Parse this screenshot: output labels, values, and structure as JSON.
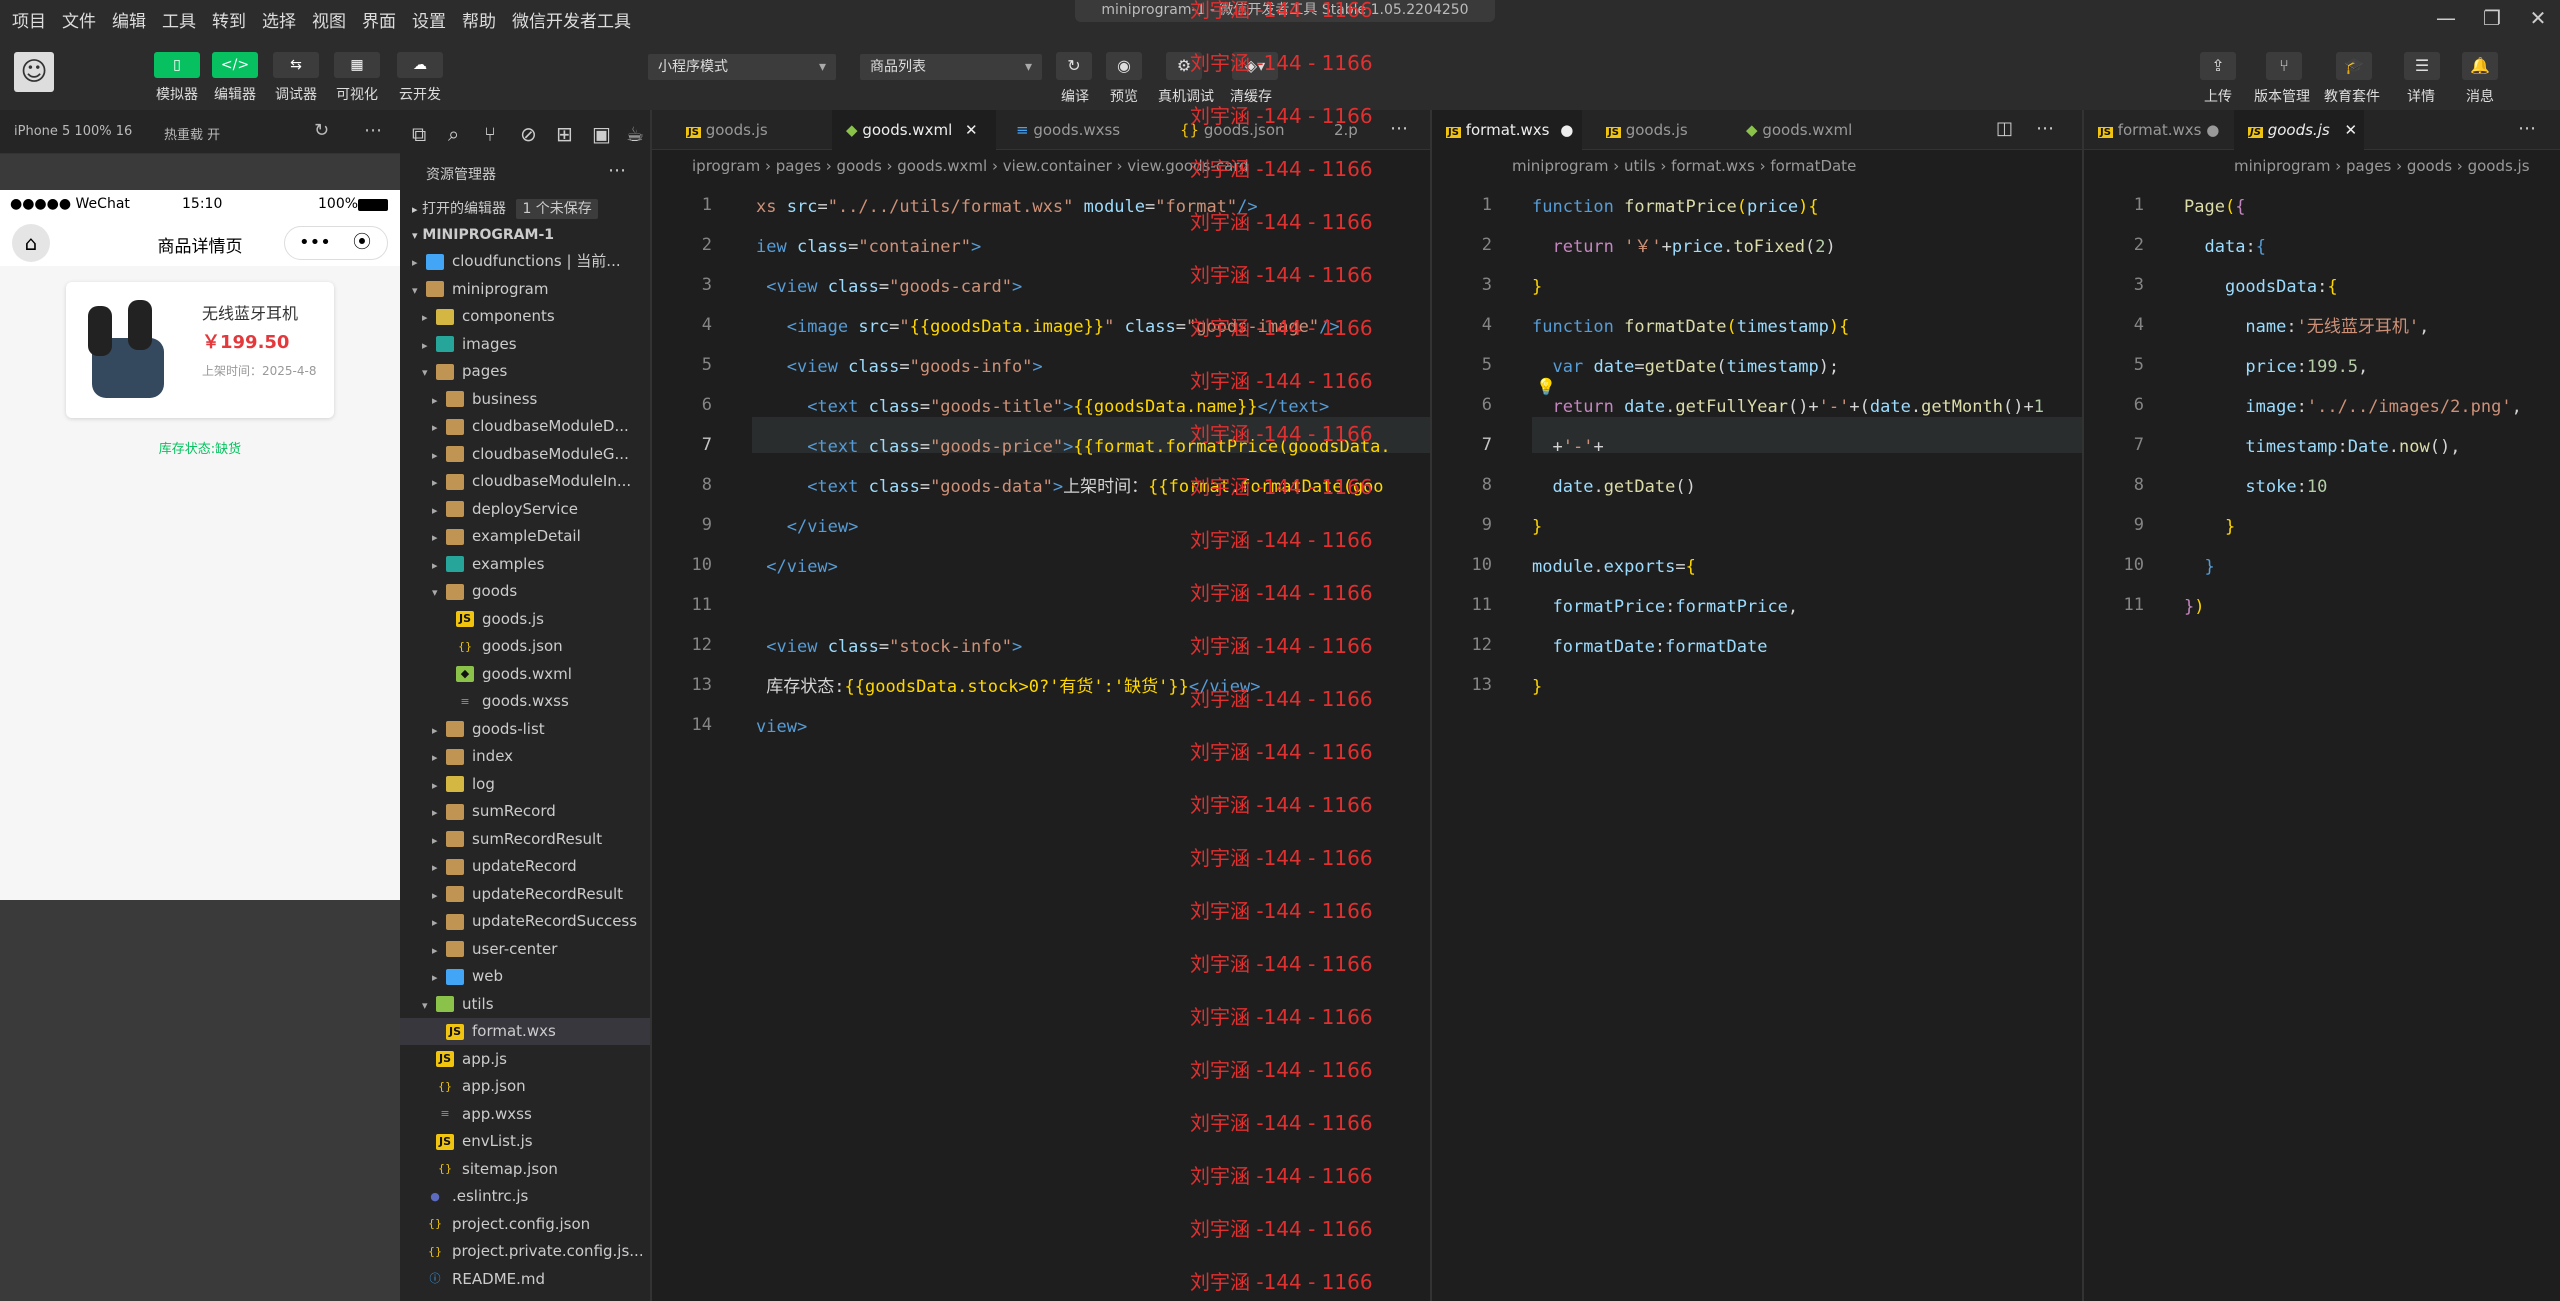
{
  "menu": [
    "项目",
    "文件",
    "编辑",
    "工具",
    "转到",
    "选择",
    "视图",
    "界面",
    "设置",
    "帮助",
    "微信开发者工具"
  ],
  "window_title": "miniprogram-1 - 微信开发者工具 Stable 1.05.2204250",
  "toolbar": {
    "simulator": "模拟器",
    "editor": "编辑器",
    "debugger": "调试器",
    "visual": "可视化",
    "cloud": "云开发",
    "mode_select": "小程序模式",
    "page_select": "商品列表",
    "compile": "编译",
    "preview": "预览",
    "remote_debug": "真机调试",
    "clear_cache": "清缓存",
    "upload": "上传",
    "version": "版本管理",
    "edu": "教育套件",
    "details": "详情",
    "messages": "消息"
  },
  "simbar": {
    "device": "iPhone 5 100% 16",
    "hot_reload": "热重载 开"
  },
  "phone": {
    "carrier": "●●●●● WeChat",
    "time": "15:10",
    "battery": "100%",
    "nav_title": "商品详情页",
    "goods_title": "无线蓝牙耳机",
    "goods_price": "￥199.50",
    "goods_date": "上架时间：2025-4-8",
    "stock": "库存状态:缺货"
  },
  "explorer": {
    "title": "资源管理器",
    "open_editors": "打开的编辑器",
    "unsaved": "1 个未保存",
    "project": "MINIPROGRAM-1",
    "items": [
      {
        "label": "cloudfunctions | 当前...",
        "depth": 1,
        "type": "folder-blue",
        "arrow": "▸"
      },
      {
        "label": "miniprogram",
        "depth": 1,
        "type": "folder",
        "arrow": "▾"
      },
      {
        "label": "components",
        "depth": 2,
        "type": "folder-yellow",
        "arrow": "▸"
      },
      {
        "label": "images",
        "depth": 2,
        "type": "folder-teal",
        "arrow": "▸"
      },
      {
        "label": "pages",
        "depth": 2,
        "type": "folder",
        "arrow": "▾"
      },
      {
        "label": "business",
        "depth": 3,
        "type": "folder",
        "arrow": "▸"
      },
      {
        "label": "cloudbaseModuleD...",
        "depth": 3,
        "type": "folder",
        "arrow": "▸"
      },
      {
        "label": "cloudbaseModuleG...",
        "depth": 3,
        "type": "folder",
        "arrow": "▸"
      },
      {
        "label": "cloudbaseModuleIn...",
        "depth": 3,
        "type": "folder",
        "arrow": "▸"
      },
      {
        "label": "deployService",
        "depth": 3,
        "type": "folder",
        "arrow": "▸"
      },
      {
        "label": "exampleDetail",
        "depth": 3,
        "type": "folder",
        "arrow": "▸"
      },
      {
        "label": "examples",
        "depth": 3,
        "type": "folder-teal",
        "arrow": "▸"
      },
      {
        "label": "goods",
        "depth": 3,
        "type": "folder",
        "arrow": "▾"
      },
      {
        "label": "goods.js",
        "depth": 4,
        "type": "js",
        "arrow": ""
      },
      {
        "label": "goods.json",
        "depth": 4,
        "type": "json",
        "arrow": ""
      },
      {
        "label": "goods.wxml",
        "depth": 4,
        "type": "wxml",
        "arrow": ""
      },
      {
        "label": "goods.wxss",
        "depth": 4,
        "type": "wxss",
        "arrow": ""
      },
      {
        "label": "goods-list",
        "depth": 3,
        "type": "folder",
        "arrow": "▸"
      },
      {
        "label": "index",
        "depth": 3,
        "type": "folder",
        "arrow": "▸"
      },
      {
        "label": "log",
        "depth": 3,
        "type": "folder-yellow",
        "arrow": "▸"
      },
      {
        "label": "sumRecord",
        "depth": 3,
        "type": "folder",
        "arrow": "▸"
      },
      {
        "label": "sumRecordResult",
        "depth": 3,
        "type": "folder",
        "arrow": "▸"
      },
      {
        "label": "updateRecord",
        "depth": 3,
        "type": "folder",
        "arrow": "▸"
      },
      {
        "label": "updateRecordResult",
        "depth": 3,
        "type": "folder",
        "arrow": "▸"
      },
      {
        "label": "updateRecordSuccess",
        "depth": 3,
        "type": "folder",
        "arrow": "▸"
      },
      {
        "label": "user-center",
        "depth": 3,
        "type": "folder",
        "arrow": "▸"
      },
      {
        "label": "web",
        "depth": 3,
        "type": "folder-blue",
        "arrow": "▸"
      },
      {
        "label": "utils",
        "depth": 2,
        "type": "folder-green",
        "arrow": "▾"
      },
      {
        "label": "format.wxs",
        "depth": 3,
        "type": "js",
        "arrow": "",
        "selected": true
      },
      {
        "label": "app.js",
        "depth": 2,
        "type": "js",
        "arrow": ""
      },
      {
        "label": "app.json",
        "depth": 2,
        "type": "json",
        "arrow": ""
      },
      {
        "label": "app.wxss",
        "depth": 2,
        "type": "wxss",
        "arrow": ""
      },
      {
        "label": "envList.js",
        "depth": 2,
        "type": "js",
        "arrow": ""
      },
      {
        "label": "sitemap.json",
        "depth": 2,
        "type": "json",
        "arrow": ""
      },
      {
        "label": ".eslintrc.js",
        "depth": 1,
        "type": "rc",
        "arrow": ""
      },
      {
        "label": "project.config.json",
        "depth": 1,
        "type": "json",
        "arrow": ""
      },
      {
        "label": "project.private.config.js...",
        "depth": 1,
        "type": "json",
        "arrow": ""
      },
      {
        "label": "README.md",
        "depth": 1,
        "type": "md",
        "arrow": ""
      }
    ]
  },
  "editor1": {
    "tabs": [
      "goods.js",
      "goods.wxml",
      "goods.wxss",
      "goods.json",
      "2.p"
    ],
    "breadcrumb": "iprogram › pages › goods › goods.wxml › view.container › view.goods-card",
    "lines": [
      "1",
      "2",
      "3",
      "4",
      "5",
      "6",
      "7",
      "8",
      "9",
      "10",
      "11",
      "12",
      "13",
      "14"
    ]
  },
  "editor2": {
    "tabs": [
      "format.wxs",
      "goods.js",
      "goods.wxml"
    ],
    "breadcrumb": "miniprogram › utils › format.wxs › formatDate",
    "lines": [
      "1",
      "2",
      "3",
      "4",
      "5",
      "6",
      "7",
      "8",
      "9",
      "10",
      "11",
      "12",
      "13"
    ]
  },
  "editor3": {
    "tabs": [
      "format.wxs",
      "goods.js"
    ],
    "breadcrumb": "miniprogram › pages › goods › goods.js",
    "lines": [
      "1",
      "2",
      "3",
      "4",
      "5",
      "6",
      "7",
      "8",
      "9",
      "10",
      "11"
    ]
  },
  "watermark": "刘宇涵 -144 - 1166"
}
